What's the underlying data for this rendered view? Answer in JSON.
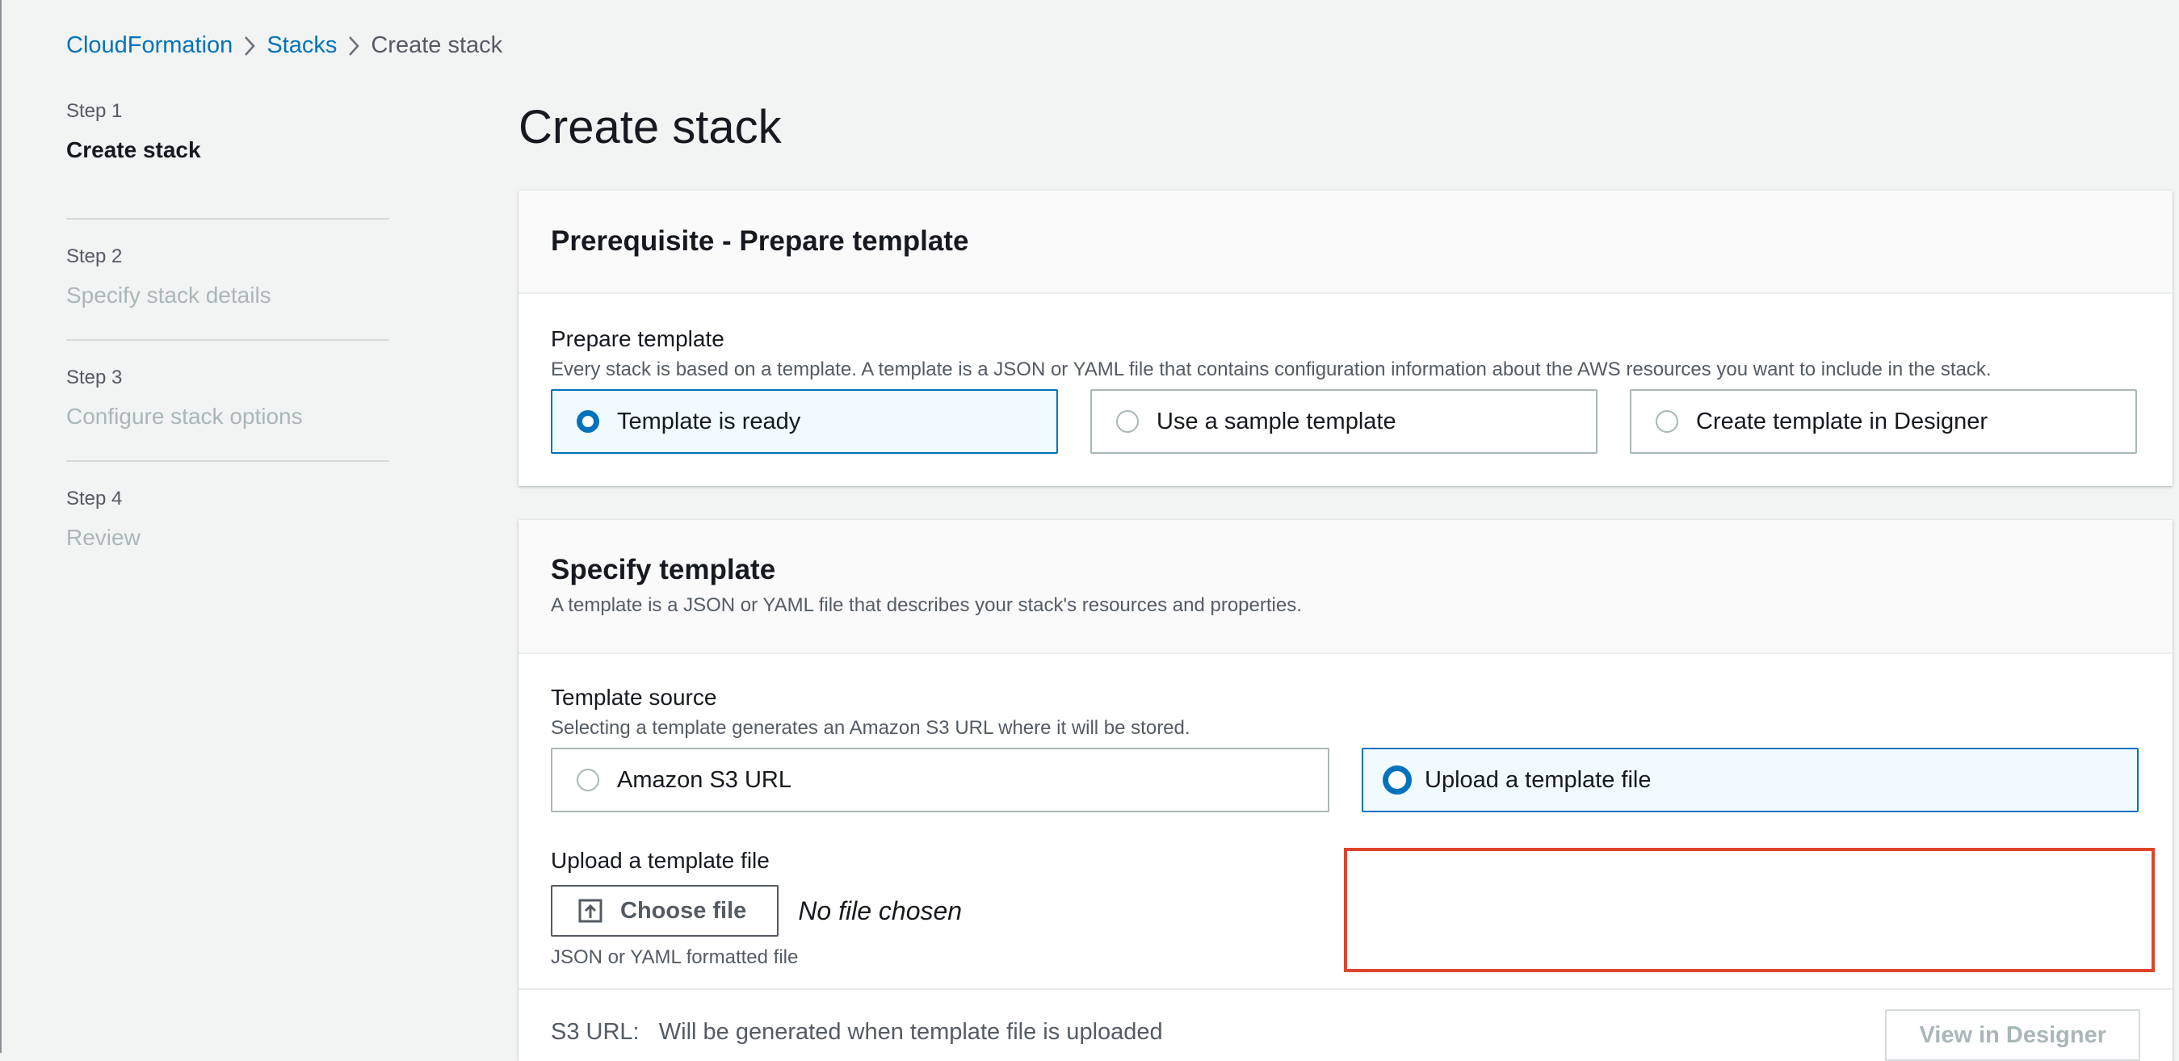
{
  "breadcrumb": {
    "items": [
      {
        "label": "CloudFormation"
      },
      {
        "label": "Stacks"
      },
      {
        "label": "Create stack"
      }
    ]
  },
  "steps": [
    {
      "step": "Step 1",
      "title": "Create stack",
      "active": true
    },
    {
      "step": "Step 2",
      "title": "Specify stack details",
      "active": false
    },
    {
      "step": "Step 3",
      "title": "Configure stack options",
      "active": false
    },
    {
      "step": "Step 4",
      "title": "Review",
      "active": false
    }
  ],
  "page_title": "Create stack",
  "prerequisite": {
    "title": "Prerequisite - Prepare template",
    "field_label": "Prepare template",
    "field_desc": "Every stack is based on a template. A template is a JSON or YAML file that contains configuration information about the AWS resources you want to include in the stack.",
    "options": [
      {
        "label": "Template is ready",
        "selected": true
      },
      {
        "label": "Use a sample template",
        "selected": false
      },
      {
        "label": "Create template in Designer",
        "selected": false
      }
    ]
  },
  "specify": {
    "title": "Specify template",
    "desc": "A template is a JSON or YAML file that describes your stack's resources and properties.",
    "source_label": "Template source",
    "source_desc": "Selecting a template generates an Amazon S3 URL where it will be stored.",
    "options": [
      {
        "label": "Amazon S3 URL",
        "selected": false
      },
      {
        "label": "Upload a template file",
        "selected": true
      }
    ],
    "upload_label": "Upload a template file",
    "choose_file": "Choose file",
    "no_file": "No file chosen",
    "upload_hint": "JSON or YAML formatted file",
    "s3_url_text": "S3 URL:   Will be generated when template file is uploaded",
    "view_designer": "View in Designer"
  },
  "colors": {
    "link": "#0073bb",
    "highlight": "#e0442b",
    "selected_bg": "#f1faff"
  }
}
